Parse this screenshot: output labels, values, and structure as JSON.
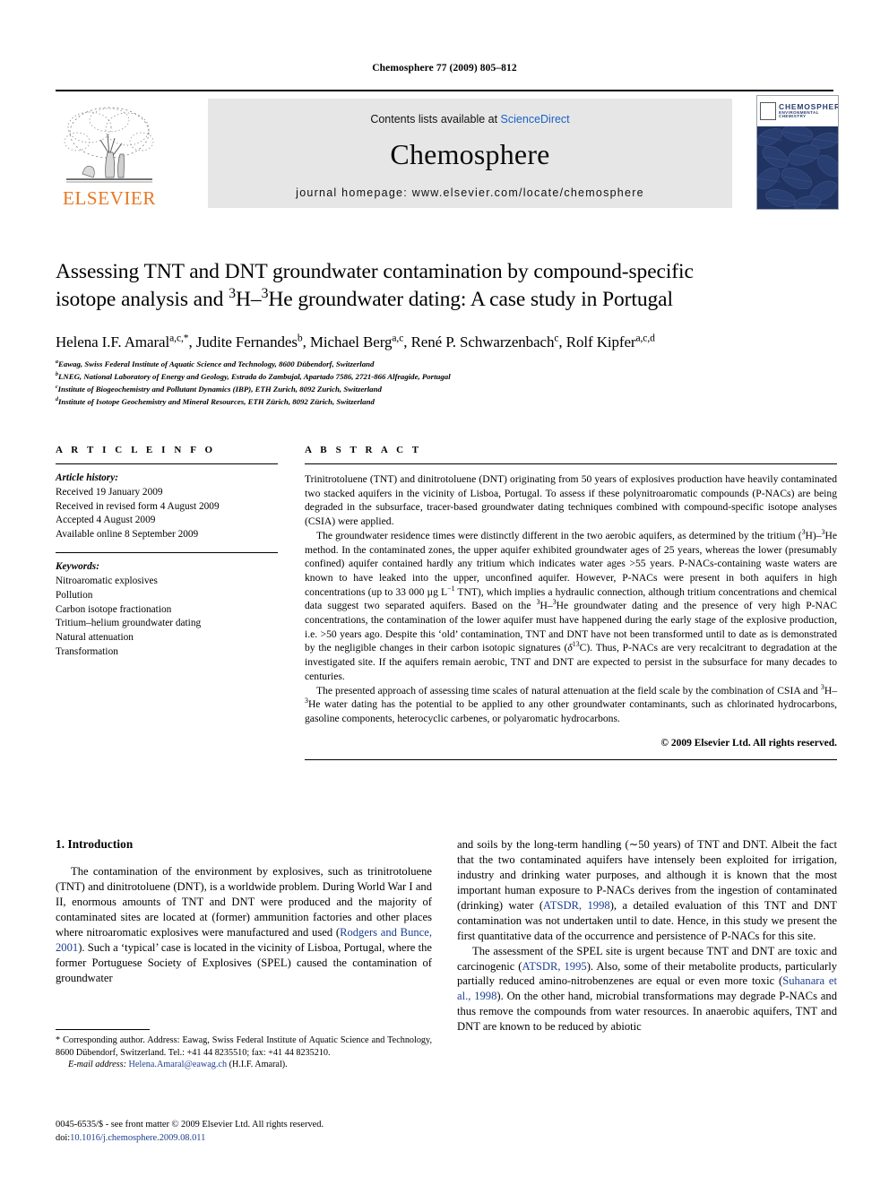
{
  "running_head": "Chemosphere 77 (2009) 805–812",
  "masthead": {
    "publisher_logo_label": "ELSEVIER",
    "contents_prefix": "Contents lists available at ",
    "contents_link": "ScienceDirect",
    "journal_title": "Chemosphere",
    "homepage": "journal homepage: www.elsevier.com/locate/chemosphere",
    "cover": {
      "title": "CHEMOSPHERE",
      "subtitle": "ENVIRONMENTAL CHEMISTRY"
    }
  },
  "article": {
    "title_line1": "Assessing TNT and DNT groundwater contamination by compound-specific",
    "title_line2_a": "isotope analysis and ",
    "title_line2_sup1": "3",
    "title_line2_b": "H–",
    "title_line2_sup2": "3",
    "title_line2_c": "He groundwater dating: A case study in Portugal",
    "authors_plain": "Helena I.F. Amaral a,c,*, Judite Fernandes b, Michael Berg a,c, René P. Schwarzenbach c, Rolf Kipfer a,c,d",
    "authors": [
      {
        "name": "Helena I.F. Amaral",
        "sup": "a,c,*"
      },
      {
        "name": "Judite Fernandes",
        "sup": "b"
      },
      {
        "name": "Michael Berg",
        "sup": "a,c"
      },
      {
        "name": "René P. Schwarzenbach",
        "sup": "c"
      },
      {
        "name": "Rolf Kipfer",
        "sup": "a,c,d"
      }
    ],
    "affiliations": [
      {
        "marker": "a",
        "text": "Eawag, Swiss Federal Institute of Aquatic Science and Technology, 8600 Dübendorf, Switzerland"
      },
      {
        "marker": "b",
        "text": "LNEG, National Laboratory of Energy and Geology, Estrada do Zambujal, Apartado 7586, 2721-866 Alfragide, Portugal"
      },
      {
        "marker": "c",
        "text": "Institute of Biogeochemistry and Pollutant Dynamics (IBP), ETH Zurich, 8092 Zurich, Switzerland"
      },
      {
        "marker": "d",
        "text": "Institute of Isotope Geochemistry and Mineral Resources, ETH Zürich, 8092 Zürich, Switzerland"
      }
    ]
  },
  "article_info": {
    "heading": "A R T I C L E   I N F O",
    "history_label": "Article history:",
    "history": [
      "Received 19 January 2009",
      "Received in revised form 4 August 2009",
      "Accepted 4 August 2009",
      "Available online 8 September 2009"
    ],
    "keywords_label": "Keywords:",
    "keywords": [
      "Nitroaromatic explosives",
      "Pollution",
      "Carbon isotope fractionation",
      "Tritium–helium groundwater dating",
      "Natural attenuation",
      "Transformation"
    ]
  },
  "abstract": {
    "heading": "A B S T R A C T",
    "paragraph1": "Trinitrotoluene (TNT) and dinitrotoluene (DNT) originating from 50 years of explosives production have heavily contaminated two stacked aquifers in the vicinity of Lisboa, Portugal. To assess if these polynitroaromatic compounds (P-NACs) are being degraded in the subsurface, tracer-based groundwater dating techniques combined with compound-specific isotope analyses (CSIA) were applied.",
    "paragraph2": "The groundwater residence times were distinctly different in the two aerobic aquifers, as determined by the tritium (3H)–3He method. In the contaminated zones, the upper aquifer exhibited groundwater ages of 25 years, whereas the lower (presumably confined) aquifer contained hardly any tritium which indicates water ages >55 years. P-NACs-containing waste waters are known to have leaked into the upper, unconfined aquifer. However, P-NACs were present in both aquifers in high concentrations (up to 33 000 µg L−1 TNT), which implies a hydraulic connection, although tritium concentrations and chemical data suggest two separated aquifers. Based on the 3H–3He groundwater dating and the presence of very high P-NAC concentrations, the contamination of the lower aquifer must have happened during the early stage of the explosive production, i.e. >50 years ago. Despite this ‘old’ contamination, TNT and DNT have not been transformed until to date as is demonstrated by the negligible changes in their carbon isotopic signatures (δ13C). Thus, P-NACs are very recalcitrant to degradation at the investigated site. If the aquifers remain aerobic, TNT and DNT are expected to persist in the subsurface for many decades to centuries.",
    "paragraph3": "The presented approach of assessing time scales of natural attenuation at the field scale by the combination of CSIA and 3H–3He water dating has the potential to be applied to any other groundwater contaminants, such as chlorinated hydrocarbons, gasoline components, heterocyclic carbenes, or polyaromatic hydrocarbons.",
    "copyright": "© 2009 Elsevier Ltd. All rights reserved."
  },
  "introduction": {
    "heading": "1. Introduction",
    "left_para1": "The contamination of the environment by explosives, such as trinitrotoluene (TNT) and dinitrotoluene (DNT), is a worldwide problem. During World War I and II, enormous amounts of TNT and DNT were produced and the majority of contaminated sites are located at (former) ammunition factories and other places where nitroaromatic explosives were manufactured and used (Rodgers and Bunce, 2001). Such a ‘typical’ case is located in the vicinity of Lisboa, Portugal, where the former Portuguese Society of Explosives (SPEL) caused the contamination of groundwater",
    "left_citation1": "Rodgers and Bunce, 2001",
    "right_para1": "and soils by the long-term handling (∼50 years) of TNT and DNT. Albeit the fact that the two contaminated aquifers have intensely been exploited for irrigation, industry and drinking water purposes, and although it is known that the most important human exposure to P-NACs derives from the ingestion of contaminated (drinking) water (ATSDR, 1998), a detailed evaluation of this TNT and DNT contamination was not undertaken until to date. Hence, in this study we present the first quantitative data of the occurrence and persistence of P-NACs for this site.",
    "right_citation1": "ATSDR, 1998",
    "right_para2": "The assessment of the SPEL site is urgent because TNT and DNT are toxic and carcinogenic (ATSDR, 1995). Also, some of their metabolite products, particularly partially reduced amino-nitrobenzenes are equal or even more toxic (Suhanara et al., 1998). On the other hand, microbial transformations may degrade P-NACs and thus remove the compounds from water resources. In anaerobic aquifers, TNT and DNT are known to be reduced by abiotic",
    "right_citation2": "ATSDR, 1995",
    "right_citation3": "Suhanara et al., 1998"
  },
  "footnote": {
    "corresponding": "* Corresponding author. Address: Eawag, Swiss Federal Institute of Aquatic Science and Technology, 8600 Dübendorf, Switzerland. Tel.: +41 44 8235510; fax: +41 44 8235210.",
    "email_label": "E-mail address:",
    "email": "Helena.Amaral@eawag.ch",
    "email_attrib": "(H.I.F. Amaral)."
  },
  "imprint": {
    "line1": "0045-6535/$ - see front matter © 2009 Elsevier Ltd. All rights reserved.",
    "doi_label": "doi:",
    "doi": "10.1016/j.chemosphere.2009.08.011"
  },
  "colors": {
    "link": "#1b3f8f",
    "elsevier_orange": "#E87722",
    "banner_grey": "#e6e6e6",
    "cover_blue": "#243a69"
  }
}
